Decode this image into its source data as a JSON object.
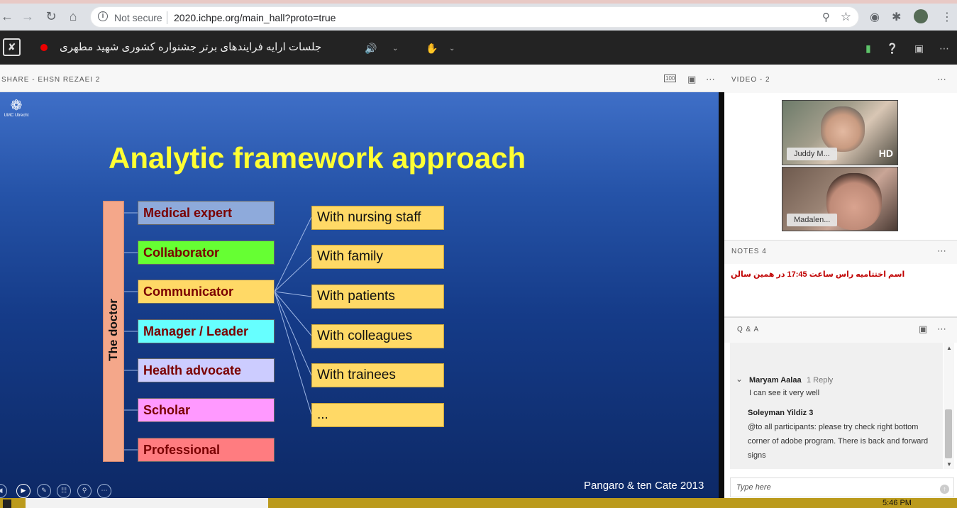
{
  "browser": {
    "secure_label": "Not secure",
    "url": "2020.ichpe.org/main_hall?proto=true"
  },
  "header": {
    "meeting_title": "جلسات ارایه فرایندهای برتر جشنواره کشوری شهید مطهری"
  },
  "share_pod": {
    "label": "SHARE  - EHSN REZAEI 2",
    "zoom_label": "100"
  },
  "slide": {
    "logo_text": "UMC Utrecht",
    "title": "Analytic framework approach",
    "doctor_label": "The doctor",
    "roles": [
      {
        "label": "Medical expert",
        "color": "#8eaadb"
      },
      {
        "label": "Collaborator",
        "color": "#66ff33"
      },
      {
        "label": "Communicator",
        "color": "#ffd966"
      },
      {
        "label": "Manager / Leader",
        "color": "#66ffff"
      },
      {
        "label": "Health advocate",
        "color": "#ccccff"
      },
      {
        "label": "Scholar",
        "color": "#ff99ff"
      },
      {
        "label": "Professional",
        "color": "#ff7c80"
      }
    ],
    "with_items": [
      "With nursing staff",
      "With family",
      "With patients",
      "With colleagues",
      "With trainees",
      "..."
    ],
    "citation": "Pangaro & ten Cate 2013"
  },
  "video_pod": {
    "title": "VIDEO  - 2",
    "tiles": [
      {
        "name": "Juddy M...",
        "badge": "HD"
      },
      {
        "name": "Madalen..."
      }
    ]
  },
  "notes_pod": {
    "title": "NOTES 4",
    "text": "اسم اختتامیه راس ساعت 17:45 در همین سالن"
  },
  "qa_pod": {
    "title": "Q & A",
    "entries": [
      {
        "author": "Maryam Aalaa",
        "replies": "1 Reply",
        "text": "I can see it very well"
      },
      {
        "author": "Soleyman Yildiz 3",
        "text": "@to all participants: please try check right bottom corner of adobe program. There is back and forward signs"
      }
    ],
    "input_placeholder": "Type here"
  },
  "taskbar": {
    "time": "5:46 PM"
  }
}
